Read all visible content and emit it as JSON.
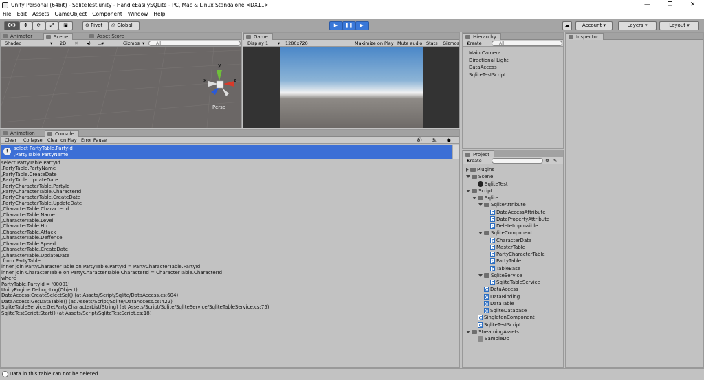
{
  "window": {
    "title": "Unity Personal (64bit) - SqliteTest.unity - HandleEasilySQLite - PC, Mac & Linux Standalone <DX11>",
    "controls": [
      "—",
      "❐",
      "✕"
    ]
  },
  "menu": [
    "File",
    "Edit",
    "Assets",
    "GameObject",
    "Component",
    "Window",
    "Help"
  ],
  "toolbar": {
    "pivot": "Pivot",
    "global": "Global",
    "account": "Account",
    "layers": "Layers",
    "layout": "Layout"
  },
  "scene_panel": {
    "tabs": [
      "Animator",
      "Scene",
      "Asset Store"
    ],
    "shading": "Shaded",
    "mode2d": "2D",
    "gizmos": "Gizmos",
    "search_placeholder": "All",
    "axes": {
      "y": "y",
      "x": "x",
      "z": "z"
    },
    "persp": "Persp"
  },
  "game_panel": {
    "tab": "Game",
    "display": "Display 1",
    "resolution": "1280x720",
    "maximize": "Maximize on Play",
    "mute": "Mute audio",
    "stats": "Stats",
    "gizmos": "Gizmos"
  },
  "console_panel": {
    "tabs": [
      "Animation",
      "Console"
    ],
    "buttons": [
      "Clear",
      "Collapse",
      "Clear on Play",
      "Error Pause"
    ],
    "counts": {
      "info": "8",
      "warn": "5",
      "error": "0"
    },
    "selected_entry": [
      "select PartyTable.PartyId",
      ",PartyTable.PartyName"
    ],
    "detail_lines": [
      "select PartyTable.PartyId",
      ",PartyTable.PartyName",
      ",PartyTable.CreateDate",
      ",PartyTable.UpdateDate",
      "",
      ",PartyCharacterTable.PartyId",
      ",PartyCharacterTable.CharacterId",
      ",PartyCharacterTable.CreateDate",
      ",PartyCharacterTable.UpdateDate",
      "",
      ",CharacterTable.CharacterId",
      ",CharacterTable.Name",
      ",CharacterTable.Level",
      ",CharacterTable.Hp",
      ",CharacterTable.Attack",
      ",CharacterTable.Deffence",
      ",CharacterTable.Speed",
      ",CharacterTable.CreateDate",
      ",CharacterTable.UpdateDate",
      "",
      " from PartyTable",
      "inner join PartyCharacterTable on PartyTable.PartyId = PartyCharacterTable.PartyId",
      "inner join CharacterTable on PartyCharacterTable.CharacterId = CharacterTable.CharacterId",
      "",
      "where",
      "PartyTable.PartyId = '00001'",
      "",
      "",
      "UnityEngine.Debug:Log(Object)",
      "DataAccess:CreateSelectSql() (at Assets/Script/Sqlite/DataAccess.cs:604)",
      "DataAccess:GetDataTable() (at Assets/Script/Sqlite/DataAccess.cs:422)",
      "SqliteTableService:GetPartyCharacterList(String) (at Assets/Script/Sqlite/SqliteService/SqliteTableService.cs:75)",
      "SqliteTestScript:Start() (at Assets/Script/SqliteTestScript.cs:18)"
    ]
  },
  "hierarchy_panel": {
    "tab": "Hierarchy",
    "create": "Create",
    "search_placeholder": "All",
    "items": [
      "Main Camera",
      "Directional Light",
      "DataAccess",
      "SqliteTestScript"
    ]
  },
  "project_panel": {
    "tab": "Project",
    "create": "Create",
    "tree": [
      {
        "label": "Plugins",
        "kind": "folder",
        "fold": "closed",
        "depth": 0
      },
      {
        "label": "Scene",
        "kind": "folder",
        "fold": "open",
        "depth": 0
      },
      {
        "label": "SqliteTest",
        "kind": "scene",
        "fold": "",
        "depth": 1
      },
      {
        "label": "Script",
        "kind": "folder",
        "fold": "open",
        "depth": 0
      },
      {
        "label": "Sqlite",
        "kind": "folder",
        "fold": "open",
        "depth": 1
      },
      {
        "label": "SqliteAttribute",
        "kind": "folder",
        "fold": "open",
        "depth": 2
      },
      {
        "label": "DataAccessAttribute",
        "kind": "script",
        "fold": "",
        "depth": 3
      },
      {
        "label": "DataPropertyAttribute",
        "kind": "script",
        "fold": "",
        "depth": 3
      },
      {
        "label": "DeleteImpossible",
        "kind": "script",
        "fold": "",
        "depth": 3
      },
      {
        "label": "SqliteComponent",
        "kind": "folder",
        "fold": "open",
        "depth": 2
      },
      {
        "label": "CharacterData",
        "kind": "script",
        "fold": "",
        "depth": 3
      },
      {
        "label": "MasterTable",
        "kind": "script",
        "fold": "",
        "depth": 3
      },
      {
        "label": "PartyCharacterTable",
        "kind": "script",
        "fold": "",
        "depth": 3
      },
      {
        "label": "PartyTable",
        "kind": "script",
        "fold": "",
        "depth": 3
      },
      {
        "label": "TableBase",
        "kind": "script",
        "fold": "",
        "depth": 3
      },
      {
        "label": "SqliteService",
        "kind": "folder",
        "fold": "open",
        "depth": 2
      },
      {
        "label": "SqliteTableService",
        "kind": "script",
        "fold": "",
        "depth": 3
      },
      {
        "label": "DataAccess",
        "kind": "script",
        "fold": "",
        "depth": 2
      },
      {
        "label": "DataBinding",
        "kind": "script",
        "fold": "",
        "depth": 2
      },
      {
        "label": "DataTable",
        "kind": "script",
        "fold": "",
        "depth": 2
      },
      {
        "label": "SqliteDatabase",
        "kind": "script",
        "fold": "",
        "depth": 2
      },
      {
        "label": "SingletonComponent",
        "kind": "script",
        "fold": "",
        "depth": 1
      },
      {
        "label": "SqliteTestScript",
        "kind": "script",
        "fold": "",
        "depth": 1
      },
      {
        "label": "StreamingAssets",
        "kind": "folder",
        "fold": "open",
        "depth": 0
      },
      {
        "label": "SampleDb",
        "kind": "db",
        "fold": "",
        "depth": 1
      }
    ]
  },
  "inspector_panel": {
    "tab": "Inspector"
  },
  "status": {
    "message": "Data in this table can not be deleted"
  },
  "colors": {
    "selection": "#3c6fd6",
    "play_blue": "#3a78d8",
    "scene_bg": "#6b6766",
    "toolbar": "#a5a5a5"
  }
}
